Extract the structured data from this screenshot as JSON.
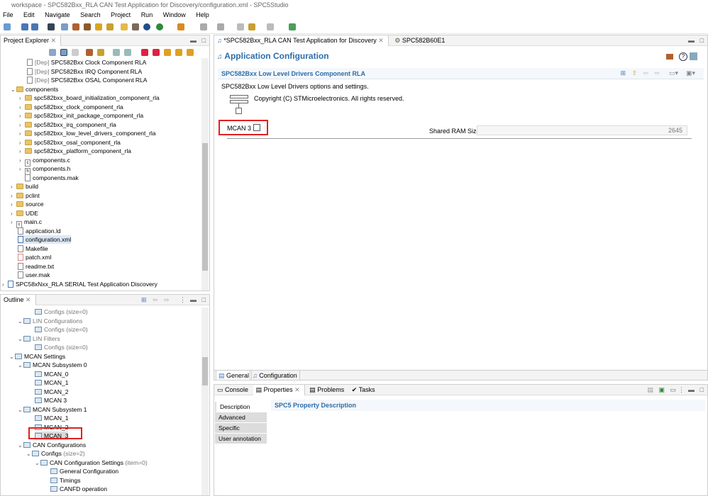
{
  "window": {
    "title": "workspace - SPC582Bxx_RLA CAN Test Application for Discovery/configuration.xml - SPC5Studio"
  },
  "menu": [
    "File",
    "Edit",
    "Navigate",
    "Search",
    "Project",
    "Run",
    "Window",
    "Help"
  ],
  "project_explorer": {
    "title": "Project Explorer",
    "items": [
      {
        "label": "SPC582Bxx Clock Component RLA",
        "prefix": "[Dep]"
      },
      {
        "label": "SPC582Bxx IRQ Component RLA",
        "prefix": "[Dep]"
      },
      {
        "label": "SPC582Bxx OSAL Component RLA",
        "prefix": "[Dep]"
      },
      {
        "label": "components"
      },
      {
        "label": "spc582bxx_board_initialization_component_rla"
      },
      {
        "label": "spc582bxx_clock_component_rla"
      },
      {
        "label": "spc582bxx_init_package_component_rla"
      },
      {
        "label": "spc582bxx_irq_component_rla"
      },
      {
        "label": "spc582bxx_low_level_drivers_component_rla"
      },
      {
        "label": "spc582bxx_osal_component_rla"
      },
      {
        "label": "spc582bxx_platform_component_rla"
      },
      {
        "label": "components.c"
      },
      {
        "label": "components.h"
      },
      {
        "label": "components.mak"
      },
      {
        "label": "build"
      },
      {
        "label": "pclint"
      },
      {
        "label": "source"
      },
      {
        "label": "UDE"
      },
      {
        "label": "main.c"
      },
      {
        "label": "application.ld"
      },
      {
        "label": "configuration.xml"
      },
      {
        "label": "Makefile"
      },
      {
        "label": "patch.xml"
      },
      {
        "label": "readme.txt"
      },
      {
        "label": "user.mak"
      },
      {
        "label": "SPC58xNxx_RLA SERIAL Test Application Discovery"
      }
    ]
  },
  "outline": {
    "title": "Outline",
    "items": [
      {
        "label": "Configs",
        "suffix": "(size=0)"
      },
      {
        "label": "LIN Configurations"
      },
      {
        "label": "Configs",
        "suffix": "(size=0)"
      },
      {
        "label": "LIN Filters"
      },
      {
        "label": "Configs",
        "suffix": "(size=0)"
      },
      {
        "label": "MCAN Settings"
      },
      {
        "label": "MCAN Subsystem 0"
      },
      {
        "label": "MCAN_0"
      },
      {
        "label": "MCAN_1"
      },
      {
        "label": "MCAN_2"
      },
      {
        "label": "MCAN 3"
      },
      {
        "label": "MCAN Subsystem 1"
      },
      {
        "label": "MCAN_1"
      },
      {
        "label": "MCAN_2"
      },
      {
        "label": "MCAN_3"
      },
      {
        "label": "CAN Configurations"
      },
      {
        "label": "Configs",
        "suffix": "(size=2)"
      },
      {
        "label": "CAN Configuration Settings",
        "suffix": "(item=0)"
      },
      {
        "label": "General Configuration"
      },
      {
        "label": "Timings"
      },
      {
        "label": "CANFD operation"
      }
    ]
  },
  "editor": {
    "tabs": [
      "*SPC582Bxx_RLA CAN Test Application for Discovery",
      "SPC582B60E1"
    ],
    "page_title": "Application Configuration",
    "section_title": "SPC582Bxx Low Level Drivers Component RLA",
    "section_desc": "SPC582Bxx Low Level Drivers options and settings.",
    "copyright": "Copyright (C) STMicroelectronics. All rights reserved.",
    "mcan_label": "MCAN 3",
    "shared_ram_label": "Shared RAM Size",
    "shared_ram_value": "2645",
    "bottom_tabs": [
      "General",
      "Configuration"
    ]
  },
  "properties": {
    "tabs": [
      "Console",
      "Properties",
      "Problems",
      "Tasks"
    ],
    "side_tabs": [
      "Description",
      "Advanced",
      "Specific",
      "User annotation"
    ],
    "heading": "SPC5 Property Description"
  }
}
